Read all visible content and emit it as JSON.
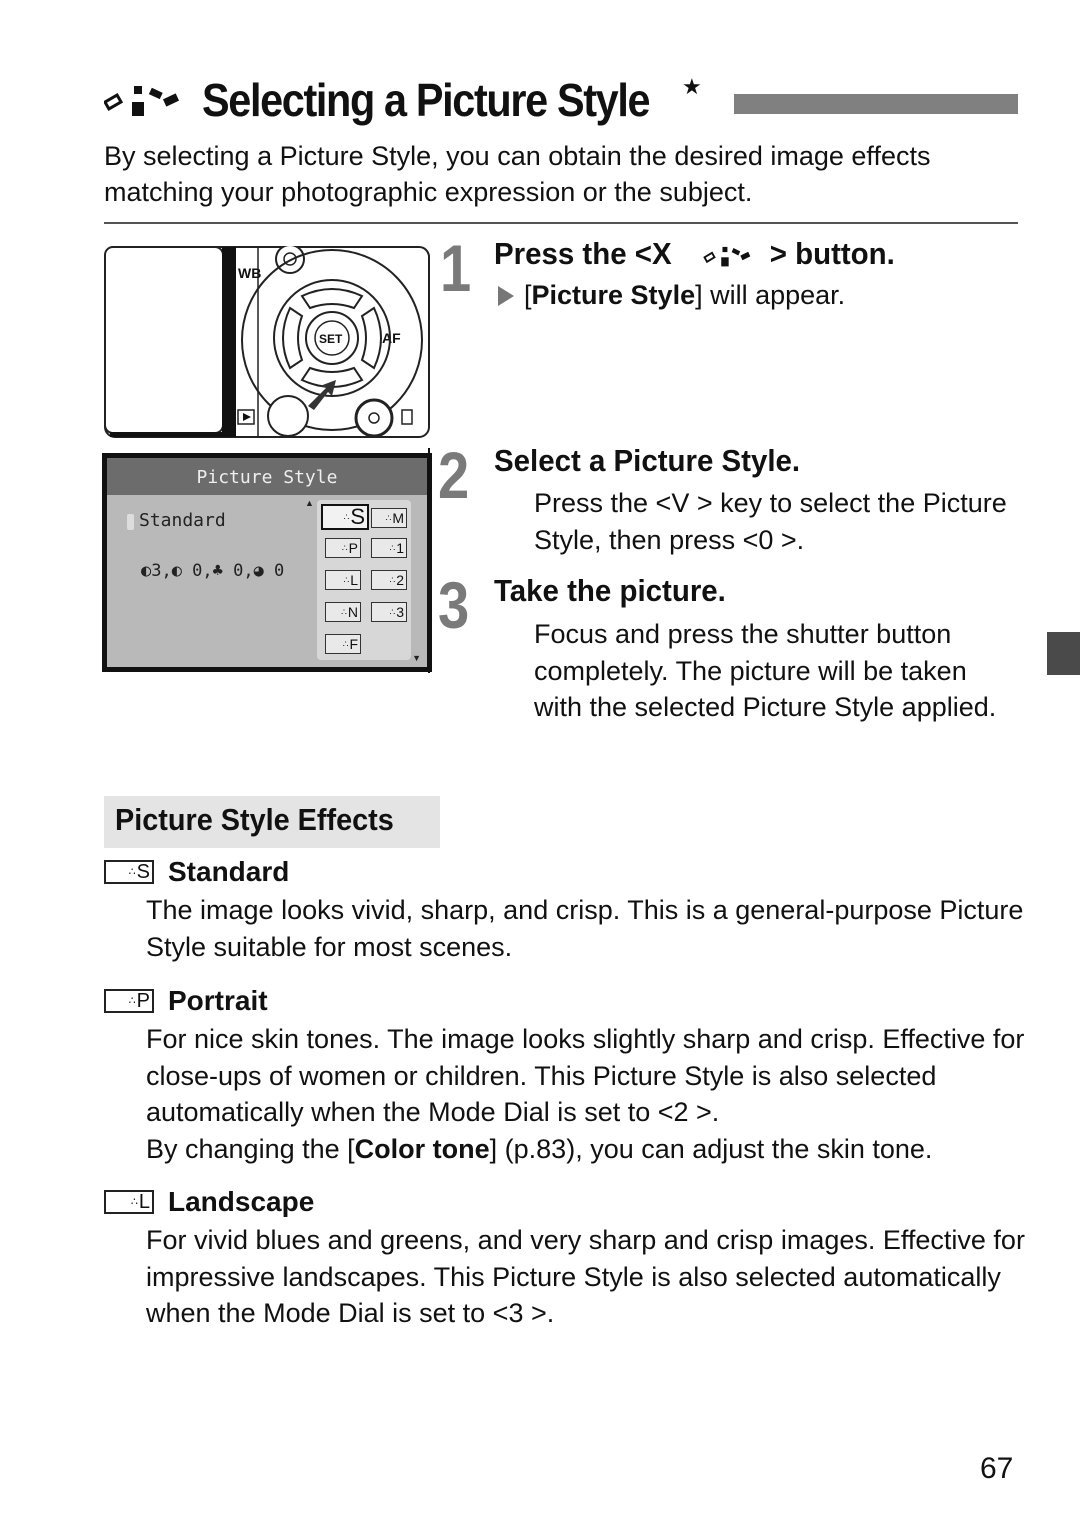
{
  "header": {
    "title": "Selecting a Picture Style",
    "title_marker": "★",
    "intro": "By selecting a Picture Style, you can obtain the desired image effects matching your photographic expression or the subject."
  },
  "camera_illustration": {
    "labels": {
      "wb": "WB",
      "af": "AF",
      "set": "SET"
    }
  },
  "lcd_screen": {
    "header": "Picture Style",
    "selected_style": "Standard",
    "params": "◐3,◐ 0,♣ 0,◕ 0",
    "styles": [
      {
        "code": "S",
        "selected": true
      },
      {
        "code": "M",
        "selected": false
      },
      {
        "code": "P",
        "selected": false
      },
      {
        "code": "1",
        "selected": false
      },
      {
        "code": "L",
        "selected": false
      },
      {
        "code": "2",
        "selected": false
      },
      {
        "code": "N",
        "selected": false
      },
      {
        "code": "3",
        "selected": false
      },
      {
        "code": "F",
        "selected": false
      }
    ],
    "scroll_up": "▲",
    "scroll_down": "▼"
  },
  "steps": [
    {
      "number": "1",
      "title_prefix": "Press the <X",
      "title_suffix": "> button.",
      "result_bold": "Picture Style",
      "result_pre": "[",
      "result_post": "] will appear."
    },
    {
      "number": "2",
      "title": "Select a Picture Style.",
      "body": "Press the <V    > key to select the Picture Style, then press <0   >."
    },
    {
      "number": "3",
      "title": "Take the picture.",
      "body": "Focus and press the shutter button completely. The picture will be taken with the selected Picture Style applied."
    }
  ],
  "effects": {
    "title": "Picture Style Effects",
    "items": [
      {
        "code": "S",
        "name": "Standard",
        "body": "The image looks vivid, sharp, and crisp. This is a general-purpose Picture Style suitable for most scenes."
      },
      {
        "code": "P",
        "name": "Portrait",
        "body_1": "For nice skin tones. The image looks slightly sharp and crisp. Effective for close-ups of women or children. This Picture Style is also selected automatically when the Mode Dial is set to <2  >.",
        "body_2_pre": "By changing the [",
        "body_2_bold": "Color tone",
        "body_2_post": "] (p.83), you can adjust the skin tone."
      },
      {
        "code": "L",
        "name": "Landscape",
        "body": "For vivid blues and greens, and very sharp and crisp images. Effective for impressive landscapes. This Picture Style is also selected automatically when the Mode Dial is set to <3   >."
      }
    ]
  },
  "icon_glyph": "∴",
  "page_number": "67"
}
